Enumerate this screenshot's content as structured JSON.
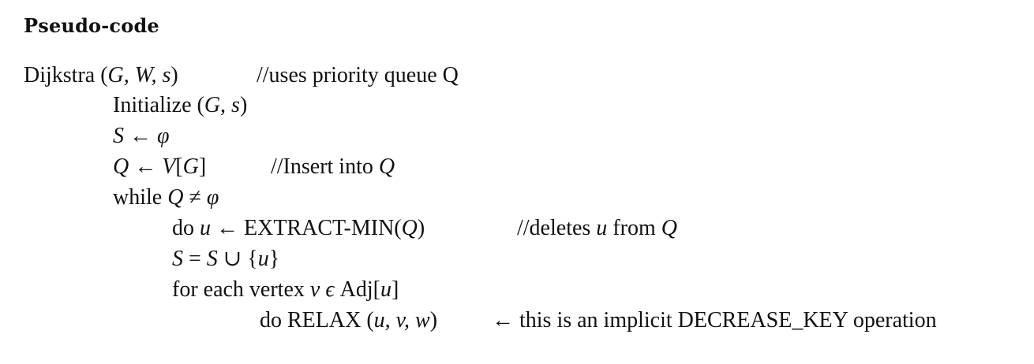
{
  "heading": "Pseudo-code",
  "lines": {
    "l0": {
      "pre": "Dijkstra (",
      "args": "G, W, s",
      "post": ")",
      "comment": "//uses priority queue Q"
    },
    "l1": {
      "pre": "Initialize (",
      "args": "G, s",
      "post": ")"
    },
    "l2": {
      "lhs": "S",
      "op": " ← ",
      "rhs": "φ"
    },
    "l3": {
      "lhs": "Q",
      "op": " ← ",
      "rhs_a": "V",
      "rhs_b": "[",
      "rhs_c": "G",
      "rhs_d": "]",
      "comment_pre": "//Insert into ",
      "comment_var": "Q"
    },
    "l4": {
      "kw": "while ",
      "a": "Q",
      "op": " ≠ ",
      "b": "φ"
    },
    "l5": {
      "kw": "do ",
      "v": "u",
      "op": " ← EXTRACT-MIN(",
      "arg": "Q",
      "close": ")",
      "comment_pre": "//deletes ",
      "comment_v": "u",
      "comment_mid": " from ",
      "comment_q": "Q"
    },
    "l6": {
      "a": "S",
      "op1": " = ",
      "b": "S",
      "op2": " ∪ {",
      "c": "u",
      "close": "}"
    },
    "l7": {
      "pre": "for each vertex ",
      "v": "v",
      "eps": " ϵ ",
      "adj": "Adj[",
      "u": "u",
      "close": "]"
    },
    "l8": {
      "pre": "do RELAX (",
      "args": "u, v, w",
      "close": ")",
      "arrow": "←",
      "note": "this is an implicit DECREASE_KEY operation"
    }
  }
}
